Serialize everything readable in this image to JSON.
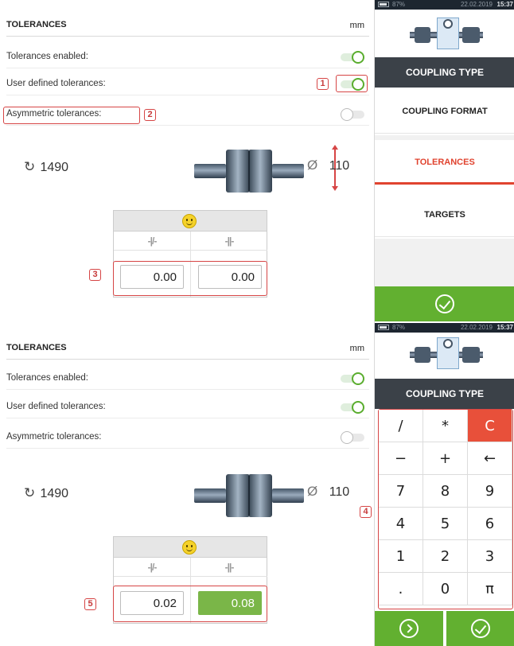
{
  "screens": [
    {
      "header": {
        "title": "TOLERANCES",
        "unit": "mm"
      },
      "toggles": [
        {
          "label": "Tolerances enabled:",
          "state": "on"
        },
        {
          "label": "User defined tolerances:",
          "state": "on"
        },
        {
          "label": "Asymmetric tolerances:",
          "state": "off"
        }
      ],
      "rpm": "1490",
      "diameter": "110",
      "table": {
        "col1_icon": "-|/-",
        "col2_icon": "-||-",
        "value1": "0.00",
        "value2": "0.00"
      },
      "callouts": [
        "1",
        "2",
        "3"
      ],
      "status": {
        "battery": "87%",
        "date": "22.02.2019",
        "time": "15:37"
      },
      "menu": [
        "COUPLING TYPE",
        "COUPLING FORMAT",
        "TOLERANCES",
        "TARGETS"
      ],
      "active_menu": "TOLERANCES"
    },
    {
      "header": {
        "title": "TOLERANCES",
        "unit": "mm"
      },
      "toggles": [
        {
          "label": "Tolerances enabled:",
          "state": "on"
        },
        {
          "label": "User defined tolerances:",
          "state": "on"
        },
        {
          "label": "Asymmetric tolerances:",
          "state": "off"
        }
      ],
      "rpm": "1490",
      "diameter": "110",
      "table": {
        "col1_icon": "-|/-",
        "col2_icon": "-||-",
        "value1": "0.02",
        "value2": "0.08"
      },
      "callouts": [
        "4",
        "5"
      ],
      "status": {
        "battery": "87%",
        "date": "22.02.2019",
        "time": "15:37"
      },
      "menu": [
        "COUPLING TYPE"
      ],
      "keypad": [
        "/",
        "*",
        "C",
        "−",
        "+",
        "←",
        "7",
        "8",
        "9",
        "4",
        "5",
        "6",
        "1",
        "2",
        "3",
        ".",
        "0",
        "π"
      ]
    }
  ],
  "colors": {
    "accent_green": "#62b030",
    "accent_red": "#e0432f",
    "dark_menu": "#3b4148"
  }
}
